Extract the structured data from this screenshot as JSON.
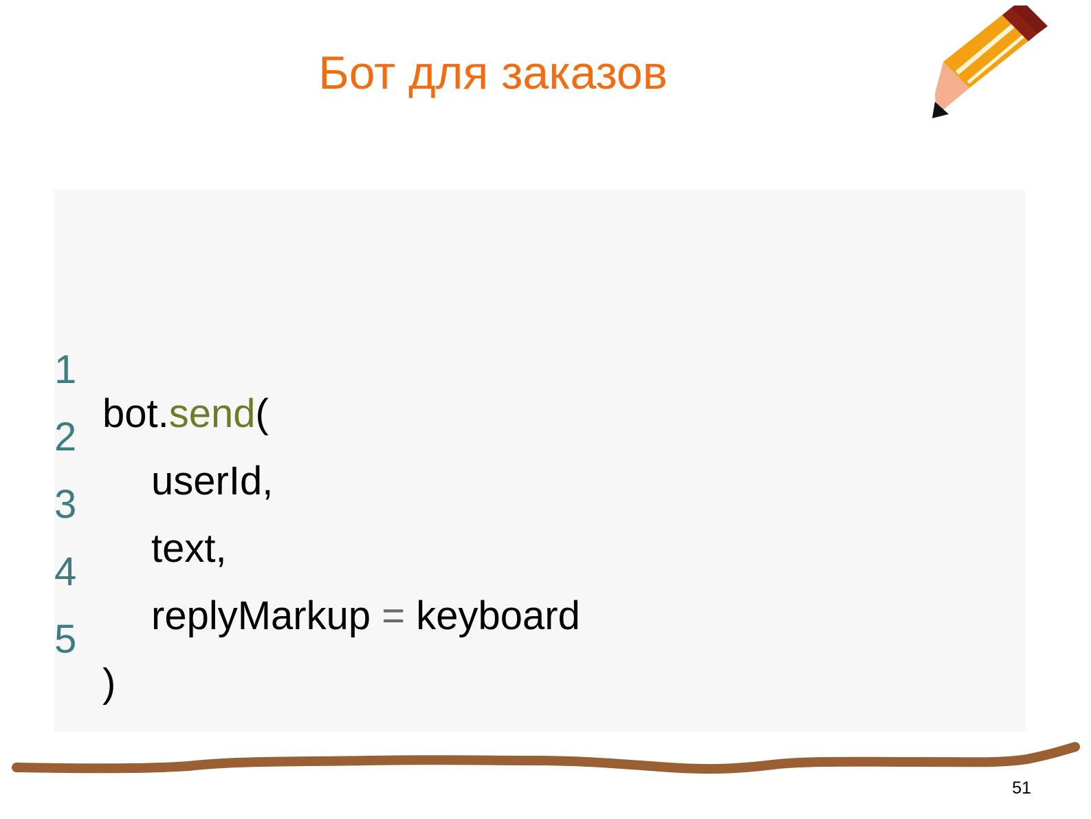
{
  "slide": {
    "title": "Бот для заказов",
    "page_number": "51"
  },
  "code": {
    "lines": [
      {
        "number": "1",
        "parts": [
          "bot.",
          "send",
          "("
        ]
      },
      {
        "number": "2",
        "parts": [
          "userId,"
        ]
      },
      {
        "number": "3",
        "parts": [
          "text,"
        ]
      },
      {
        "number": "4",
        "parts": [
          "replyMarkup ",
          "=",
          " keyboard"
        ]
      },
      {
        "number": "5",
        "parts": [
          ")"
        ]
      }
    ]
  },
  "colors": {
    "title": "#f26d12",
    "line_number": "#3d7c80",
    "function_name": "#6b7d2a",
    "operator": "#6a6a6a",
    "code_background": "#f7f7f7",
    "divider": "#9a5f32"
  },
  "icons": {
    "pencil": "pencil-icon"
  }
}
